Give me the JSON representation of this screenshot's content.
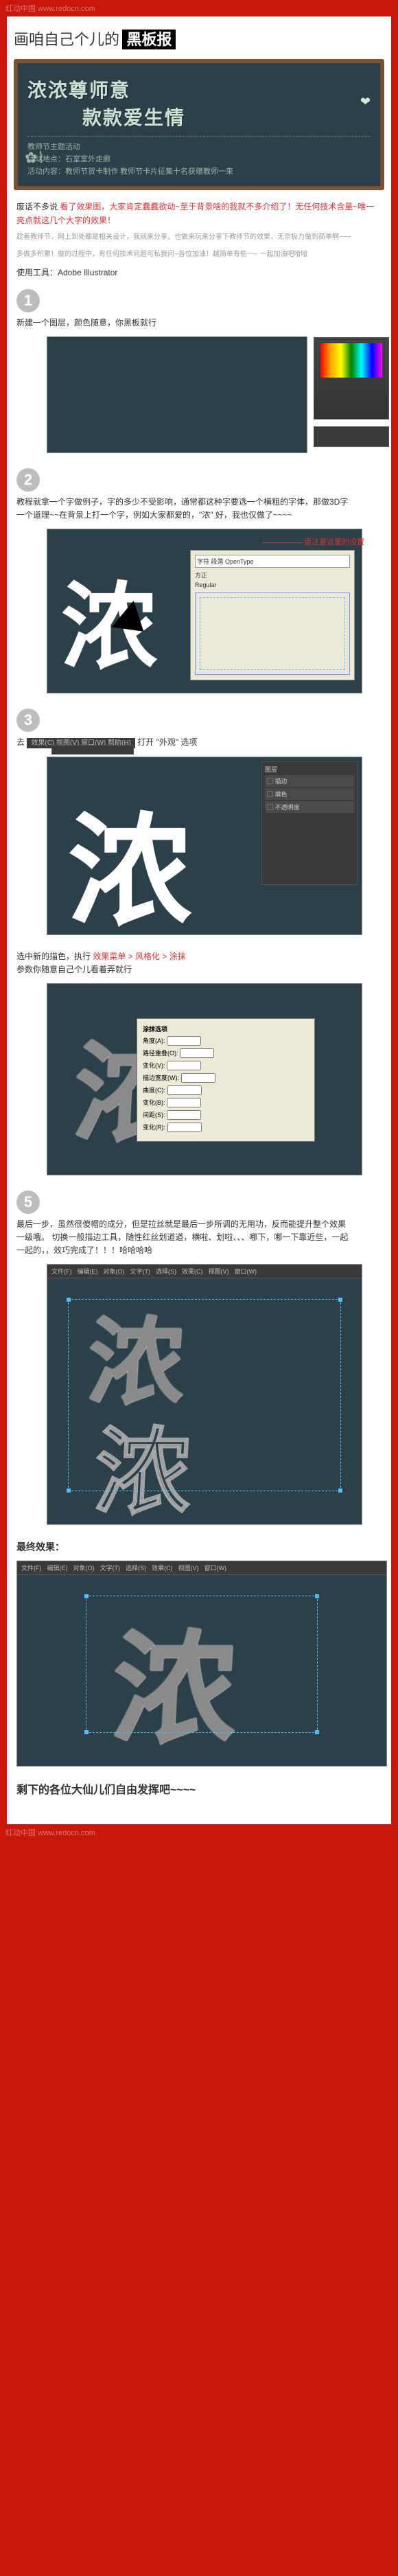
{
  "watermark": "红动中国 www.redocn.com",
  "header": {
    "lead": "画咱自己个儿的",
    "black": "黑板报"
  },
  "board": {
    "line1": "浓浓尊师意",
    "line2": "款款爱生情",
    "sub_title": "教师节主题活动",
    "info1": "活动地点：石室室外走廊",
    "info2": "活动内容：教师节贺卡制作 教师节卡片征集十名获赠教师一束"
  },
  "intro": {
    "p1a": "废话不多说 ",
    "p1b": "看了效果图，大家肯定蠢蠢欲动~至于背景啥的我就不多介绍了！无任何技术含量~唯一亮点就这几个大字的效果！",
    "p2": "趁着教师节，网上到处都是相关设计，我就来分享，也做来玩来分享下教师节的效果，无奈极力做到简单啊~~~",
    "p3": "多做多积累！做的过程中，有任何技术问题可私我问~各位加油！越简单有些一~ 一起加油吧哈哈"
  },
  "tool_label": "使用工具：Adobe Illustrator",
  "steps": {
    "s1": {
      "num": "1",
      "txt": "新建一个图层，颜色随意，你黑板就行"
    },
    "s2": {
      "num": "2",
      "txt": "教程就拿一个字做例子，字的多少不受影响，通常都这种字要选一个横粗的字体，那做3D字一个道理~~在背景上打一个字，例如大家都爱的，\"浓\"\n好，我也仅做了~~~~"
    },
    "s2_callout": "请注意这里的设置",
    "s3": {
      "num": "3",
      "txt": "去",
      "menu": "效果(C)  视图(V)  窗口(W)  帮助(H)",
      "after": "打开 \"外观\" 选项"
    },
    "s4": {
      "pre": "选中新的描色，执行 ",
      "path": "效果菜单 > 风格化 > 涂抹",
      "post": "参数你随意自己个儿看着弄就行"
    },
    "s5": {
      "num": "5",
      "txt": "最后一步，虽然很傻帽的成分，但是拉丝就是最后一步所调的无用功，反而能提升整个效果一级哦。\n切换一般描边工具，随性红丝划道道，横啦、划啦、、、哪下，哪一下靠近些，一起一起的，，效巧完成了！！！哈哈哈哈"
    }
  },
  "dialog2": {
    "title": "字符",
    "tabs": "字符 段落 OpenType",
    "font": "方正",
    "weight": "Regular"
  },
  "popup4": {
    "title": "涂抹选项",
    "r1": "角度(A):",
    "r2": "路径重叠(O):",
    "r3": "变化(V):",
    "r4": "描边宽度(W):",
    "r5": "曲度(C):",
    "r6": "变化(B):",
    "r7": "间距(S):",
    "r8": "变化(R):"
  },
  "layers": {
    "title": "图层",
    "l1": "▢ 描边",
    "l2": "▢ 填色",
    "l3": "▢ 不透明度"
  },
  "menubar": {
    "m1": "文件(F)",
    "m2": "编辑(E)",
    "m3": "对象(O)",
    "m4": "文字(T)",
    "m5": "选择(S)",
    "m6": "效果(C)",
    "m7": "视图(V)",
    "m8": "窗口(W)"
  },
  "final_label": "最终效果：",
  "ending": "剩下的各位大仙儿们自由发挥吧~~~~",
  "char": "浓"
}
